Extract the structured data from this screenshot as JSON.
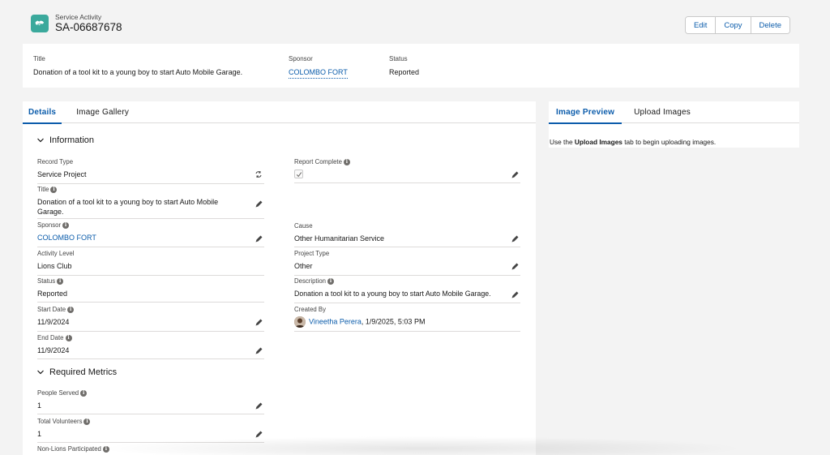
{
  "header": {
    "object_label": "Service Activity",
    "record_name": "SA-06687678",
    "buttons": {
      "edit": "Edit",
      "copy": "Copy",
      "delete": "Delete"
    }
  },
  "highlights": {
    "title_label": "Title",
    "title_value": "Donation of a tool kit to a young boy to start Auto Mobile Garage.",
    "sponsor_label": "Sponsor",
    "sponsor_value": "COLOMBO FORT",
    "status_label": "Status",
    "status_value": "Reported"
  },
  "left_tabs": {
    "details": "Details",
    "gallery": "Image Gallery"
  },
  "sections": {
    "information": "Information",
    "required_metrics": "Required Metrics"
  },
  "fields": {
    "record_type": {
      "label": "Record Type",
      "value": "Service Project"
    },
    "title": {
      "label": "Title",
      "value": "Donation of a tool kit to a young boy to start Auto Mobile Garage."
    },
    "sponsor": {
      "label": "Sponsor",
      "value": "COLOMBO FORT"
    },
    "activity_level": {
      "label": "Activity Level",
      "value": "Lions Club"
    },
    "status": {
      "label": "Status",
      "value": "Reported"
    },
    "start_date": {
      "label": "Start Date",
      "value": "11/9/2024"
    },
    "end_date": {
      "label": "End Date",
      "value": "11/9/2024"
    },
    "report_complete": {
      "label": "Report Complete",
      "checked": true
    },
    "cause": {
      "label": "Cause",
      "value": "Other Humanitarian Service"
    },
    "project_type": {
      "label": "Project Type",
      "value": "Other"
    },
    "description": {
      "label": "Description",
      "value": "Donation a tool kit to a young boy to start Auto Mobile Garage."
    },
    "created_by": {
      "label": "Created By",
      "user": "Vineetha Perera",
      "datetime": ", 1/9/2025, 5:03 PM"
    },
    "people_served": {
      "label": "People Served",
      "value": "1"
    },
    "total_volunteers": {
      "label": "Total Volunteers",
      "value": "1"
    },
    "non_lions": {
      "label": "Non-Lions Participated"
    }
  },
  "right_tabs": {
    "preview": "Image Preview",
    "upload": "Upload Images"
  },
  "preview_message": {
    "before": "Use the ",
    "bold": "Upload Images",
    "after": " tab to begin uploading images."
  },
  "colors": {
    "brand_icon": "#3ba99c",
    "link": "#0b5cab",
    "background": "#f3f3f3"
  }
}
